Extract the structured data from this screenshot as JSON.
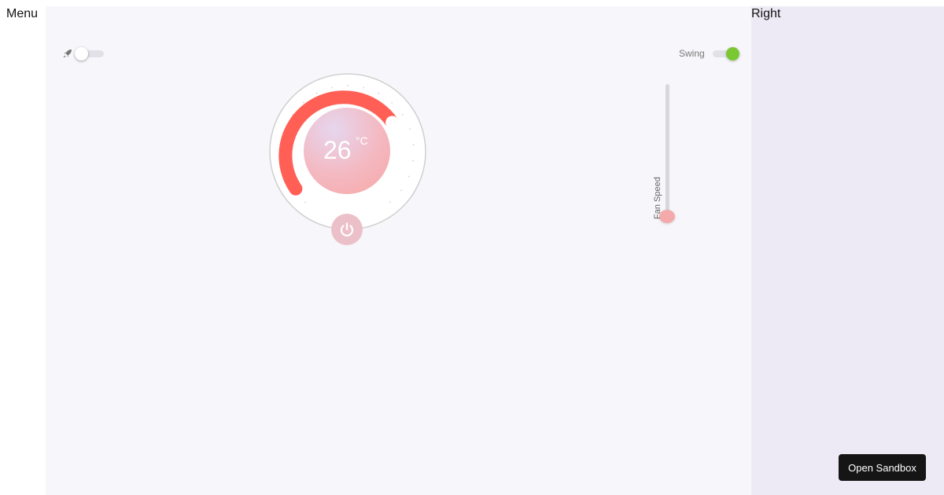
{
  "menu": {
    "title": "Menu"
  },
  "right_panel": {
    "title": "Right"
  },
  "controls": {
    "turbo": {
      "icon": "rocket-icon",
      "on": false
    },
    "swing": {
      "label": "Swing",
      "on": true,
      "accent": "#79c832"
    },
    "temperature": {
      "value": "26",
      "unit": "°C",
      "arc_color": "#ff5f55"
    },
    "power": {
      "icon": "power-icon"
    },
    "fan_speed": {
      "label": "Fan Speed",
      "level": 0,
      "thumb_color": "#f4aaab"
    }
  },
  "sandbox": {
    "button_label": "Open Sandbox"
  }
}
